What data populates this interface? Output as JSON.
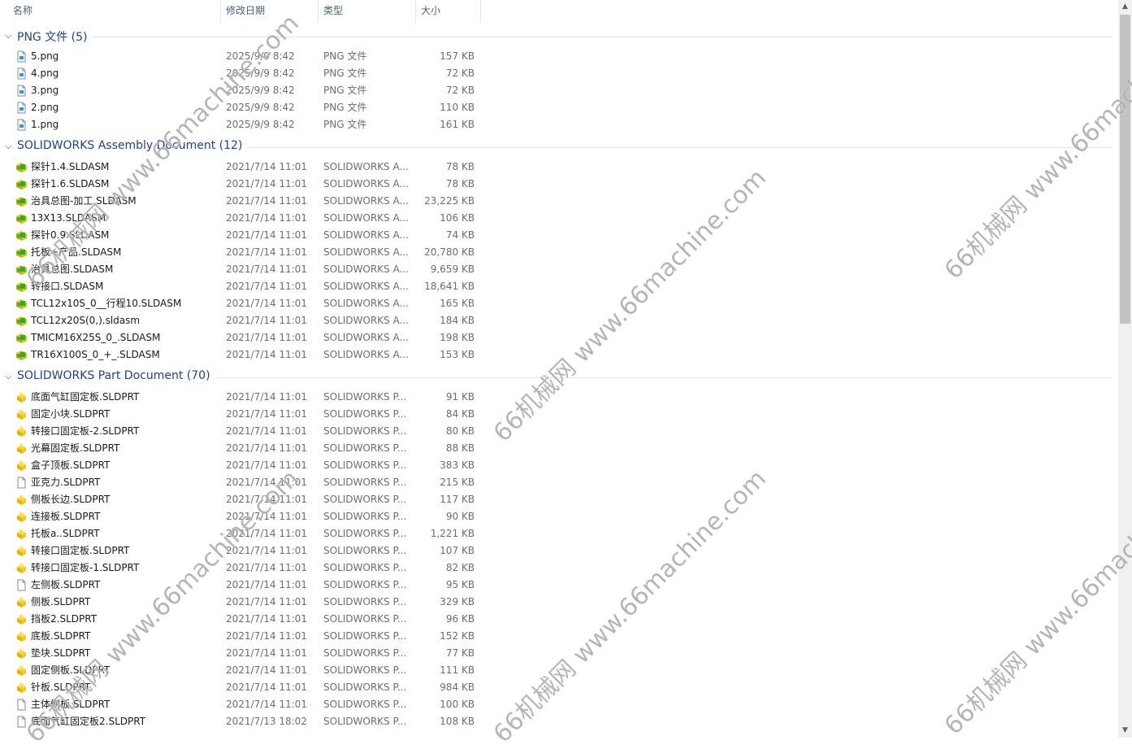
{
  "columns": {
    "name": "名称",
    "date": "修改日期",
    "type": "类型",
    "size": "大小"
  },
  "groups": [
    {
      "title": "PNG 文件 (5)",
      "icon": "png-file-icon",
      "items": [
        {
          "name": "5.png",
          "date": "2025/9/9 8:42",
          "type": "PNG 文件",
          "size": "157 KB"
        },
        {
          "name": "4.png",
          "date": "2025/9/9 8:42",
          "type": "PNG 文件",
          "size": "72 KB"
        },
        {
          "name": "3.png",
          "date": "2025/9/9 8:42",
          "type": "PNG 文件",
          "size": "72 KB"
        },
        {
          "name": "2.png",
          "date": "2025/9/9 8:42",
          "type": "PNG 文件",
          "size": "110 KB"
        },
        {
          "name": "1.png",
          "date": "2025/9/9 8:42",
          "type": "PNG 文件",
          "size": "161 KB"
        }
      ]
    },
    {
      "title": "SOLIDWORKS Assembly Document (12)",
      "icon": "sldasm-icon",
      "items": [
        {
          "name": "探针1.4.SLDASM",
          "date": "2021/7/14 11:01",
          "type": "SOLIDWORKS A...",
          "size": "78 KB"
        },
        {
          "name": "探针1.6.SLDASM",
          "date": "2021/7/14 11:01",
          "type": "SOLIDWORKS A...",
          "size": "78 KB"
        },
        {
          "name": "治具总图-加工.SLDASM",
          "date": "2021/7/14 11:01",
          "type": "SOLIDWORKS A...",
          "size": "23,225 KB"
        },
        {
          "name": "13X13.SLDASM",
          "date": "2021/7/14 11:01",
          "type": "SOLIDWORKS A...",
          "size": "106 KB"
        },
        {
          "name": "探针0.9.SLDASM",
          "date": "2021/7/14 11:01",
          "type": "SOLIDWORKS A...",
          "size": "74 KB"
        },
        {
          "name": "托板+产品.SLDASM",
          "date": "2021/7/14 11:01",
          "type": "SOLIDWORKS A...",
          "size": "20,780 KB"
        },
        {
          "name": "治具总图.SLDASM",
          "date": "2021/7/14 11:01",
          "type": "SOLIDWORKS A...",
          "size": "9,659 KB"
        },
        {
          "name": "转接口.SLDASM",
          "date": "2021/7/14 11:01",
          "type": "SOLIDWORKS A...",
          "size": "18,641 KB"
        },
        {
          "name": "TCL12x10S_0__行程10.SLDASM",
          "date": "2021/7/14 11:01",
          "type": "SOLIDWORKS A...",
          "size": "165 KB"
        },
        {
          "name": "TCL12x20S(0,).sldasm",
          "date": "2021/7/14 11:01",
          "type": "SOLIDWORKS A...",
          "size": "184 KB"
        },
        {
          "name": "TMICM16X25S_0_.SLDASM",
          "date": "2021/7/14 11:01",
          "type": "SOLIDWORKS A...",
          "size": "198 KB"
        },
        {
          "name": "TR16X100S_0_+_.SLDASM",
          "date": "2021/7/14 11:01",
          "type": "SOLIDWORKS A...",
          "size": "153 KB"
        }
      ]
    },
    {
      "title": "SOLIDWORKS Part Document (70)",
      "icon": "sldprt-icon",
      "items": [
        {
          "name": "底面气缸固定板.SLDPRT",
          "date": "2021/7/14 11:01",
          "type": "SOLIDWORKS P...",
          "size": "91 KB",
          "icon": "sldprt-icon"
        },
        {
          "name": "固定小块.SLDPRT",
          "date": "2021/7/14 11:01",
          "type": "SOLIDWORKS P...",
          "size": "84 KB",
          "icon": "sldprt-icon"
        },
        {
          "name": "转接口固定板-2.SLDPRT",
          "date": "2021/7/14 11:01",
          "type": "SOLIDWORKS P...",
          "size": "80 KB",
          "icon": "sldprt-icon"
        },
        {
          "name": "光幕固定板.SLDPRT",
          "date": "2021/7/14 11:01",
          "type": "SOLIDWORKS P...",
          "size": "88 KB",
          "icon": "sldprt-icon"
        },
        {
          "name": "盒子顶板.SLDPRT",
          "date": "2021/7/14 11:01",
          "type": "SOLIDWORKS P...",
          "size": "383 KB",
          "icon": "sldprt-icon"
        },
        {
          "name": "亚克力.SLDPRT",
          "date": "2021/7/14 11:01",
          "type": "SOLIDWORKS P...",
          "size": "215 KB",
          "icon": "blank-file-icon"
        },
        {
          "name": "侧板长边.SLDPRT",
          "date": "2021/7/14 11:01",
          "type": "SOLIDWORKS P...",
          "size": "117 KB",
          "icon": "sldprt-icon"
        },
        {
          "name": "连接板.SLDPRT",
          "date": "2021/7/14 11:01",
          "type": "SOLIDWORKS P...",
          "size": "90 KB",
          "icon": "sldprt-icon"
        },
        {
          "name": "托板a..SLDPRT",
          "date": "2021/7/14 11:01",
          "type": "SOLIDWORKS P...",
          "size": "1,221 KB",
          "icon": "sldprt-icon"
        },
        {
          "name": "转接口固定板.SLDPRT",
          "date": "2021/7/14 11:01",
          "type": "SOLIDWORKS P...",
          "size": "107 KB",
          "icon": "sldprt-icon"
        },
        {
          "name": "转接口固定板-1.SLDPRT",
          "date": "2021/7/14 11:01",
          "type": "SOLIDWORKS P...",
          "size": "82 KB",
          "icon": "sldprt-icon"
        },
        {
          "name": "左侧板.SLDPRT",
          "date": "2021/7/14 11:01",
          "type": "SOLIDWORKS P...",
          "size": "95 KB",
          "icon": "blank-file-icon"
        },
        {
          "name": "侧板.SLDPRT",
          "date": "2021/7/14 11:01",
          "type": "SOLIDWORKS P...",
          "size": "329 KB",
          "icon": "sldprt-icon"
        },
        {
          "name": "挡板2.SLDPRT",
          "date": "2021/7/14 11:01",
          "type": "SOLIDWORKS P...",
          "size": "96 KB",
          "icon": "sldprt-icon"
        },
        {
          "name": "底板.SLDPRT",
          "date": "2021/7/14 11:01",
          "type": "SOLIDWORKS P...",
          "size": "152 KB",
          "icon": "sldprt-icon"
        },
        {
          "name": "垫块.SLDPRT",
          "date": "2021/7/14 11:01",
          "type": "SOLIDWORKS P...",
          "size": "77 KB",
          "icon": "sldprt-icon"
        },
        {
          "name": "固定侧板.SLDPRT",
          "date": "2021/7/14 11:01",
          "type": "SOLIDWORKS P...",
          "size": "111 KB",
          "icon": "sldprt-icon"
        },
        {
          "name": "针板.SLDPRT",
          "date": "2021/7/14 11:01",
          "type": "SOLIDWORKS P...",
          "size": "984 KB",
          "icon": "sldprt-icon"
        },
        {
          "name": "主体侧板.SLDPRT",
          "date": "2021/7/14 11:01",
          "type": "SOLIDWORKS P...",
          "size": "100 KB",
          "icon": "blank-file-icon"
        },
        {
          "name": "底面气缸固定板2.SLDPRT",
          "date": "2021/7/13 18:02",
          "type": "SOLIDWORKS P...",
          "size": "108 KB",
          "icon": "blank-file-icon"
        }
      ]
    }
  ],
  "watermarks": [
    "66机械网 www.66machine.com"
  ]
}
